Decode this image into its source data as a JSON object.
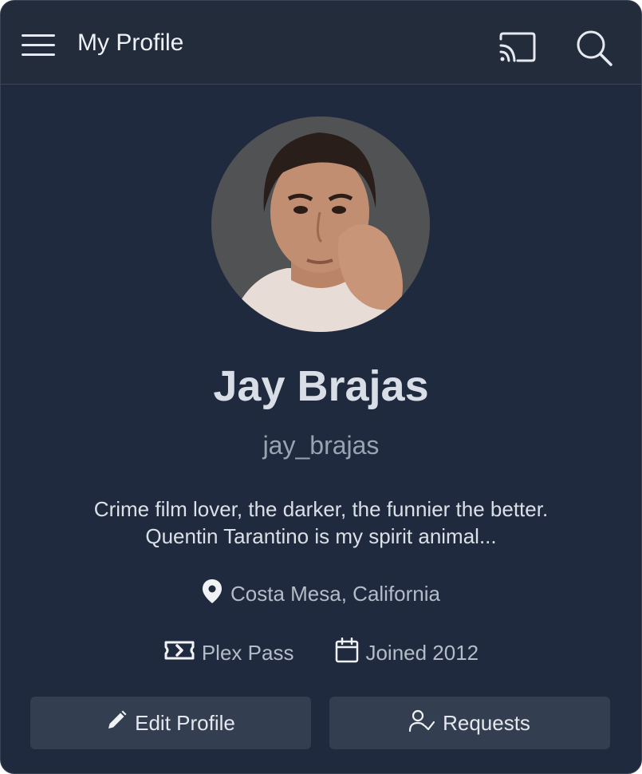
{
  "header": {
    "title": "My Profile",
    "icons": [
      "hamburger-menu-icon",
      "cast-icon",
      "search-icon"
    ]
  },
  "profile": {
    "name": "Jay Brajas",
    "username": "jay_brajas",
    "bio_line1": "Crime film lover, the darker, the funnier the better.",
    "bio_line2": "Quentin Tarantino is my spirit animal...",
    "location": "Costa Mesa, California",
    "plex_pass": "Plex Pass",
    "joined": "Joined 2012"
  },
  "actions": {
    "edit_profile": "Edit Profile",
    "requests": "Requests"
  },
  "colors": {
    "background": "#1f2a3e",
    "header": "#232c3b",
    "button": "#333e50",
    "text_primary": "#d9dee6",
    "text_muted": "#9aa3b1"
  }
}
